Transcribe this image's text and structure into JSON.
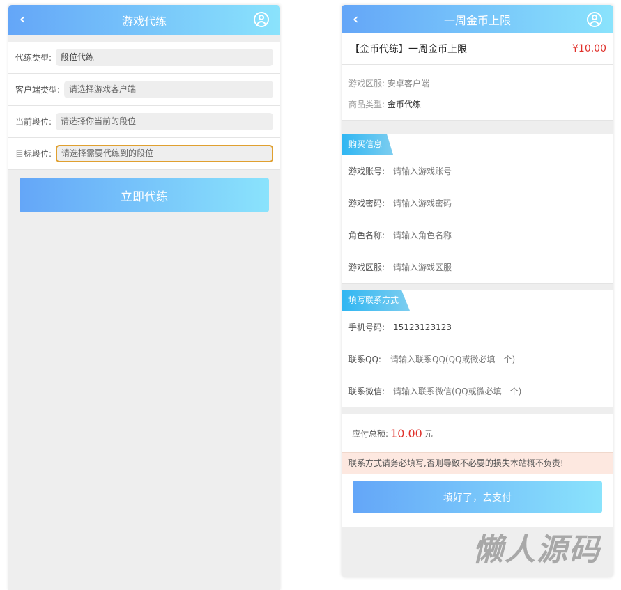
{
  "left": {
    "title": "游戏代练",
    "fields": [
      {
        "label": "代练类型:",
        "value": "段位代练"
      },
      {
        "label": "客户端类型:",
        "value": "请选择游戏客户端"
      },
      {
        "label": "当前段位:",
        "value": "请选择你当前的段位"
      },
      {
        "label": "目标段位:",
        "value": "请选择需要代练到的段位"
      }
    ],
    "submit": "立即代练"
  },
  "right": {
    "title": "一周金币上限",
    "product": "【金币代练】一周金币上限",
    "price": "¥10.00",
    "info": [
      {
        "label": "游戏区服:",
        "value": "安卓客户端"
      },
      {
        "label": "商品类型:",
        "value": "金币代练"
      }
    ],
    "section1": "购买信息",
    "buy_fields": [
      {
        "label": "游戏账号:",
        "placeholder": "请输入游戏账号"
      },
      {
        "label": "游戏密码:",
        "placeholder": "请输入游戏密码"
      },
      {
        "label": "角色名称:",
        "placeholder": "请输入角色名称"
      },
      {
        "label": "游戏区服:",
        "placeholder": "请输入游戏区服"
      }
    ],
    "section2": "填写联系方式",
    "contact_fields": [
      {
        "label": "手机号码:",
        "value": "15123123123"
      },
      {
        "label": "联系QQ:",
        "placeholder": "请输入联系QQ(QQ或微必填一个)"
      },
      {
        "label": "联系微信:",
        "placeholder": "请输入联系微信(QQ或微必填一个)"
      }
    ],
    "total_label": "应付总额:",
    "total_value": "10.00",
    "total_unit": "元",
    "notice": "联系方式请务必填写,否则导致不必要的损失本站概不负责!",
    "pay": "填好了，去支付"
  },
  "watermark": "懒人源码",
  "colors": {
    "accent_start": "#64a6f8",
    "accent_end": "#8ae3fc",
    "price": "#e0302a"
  }
}
